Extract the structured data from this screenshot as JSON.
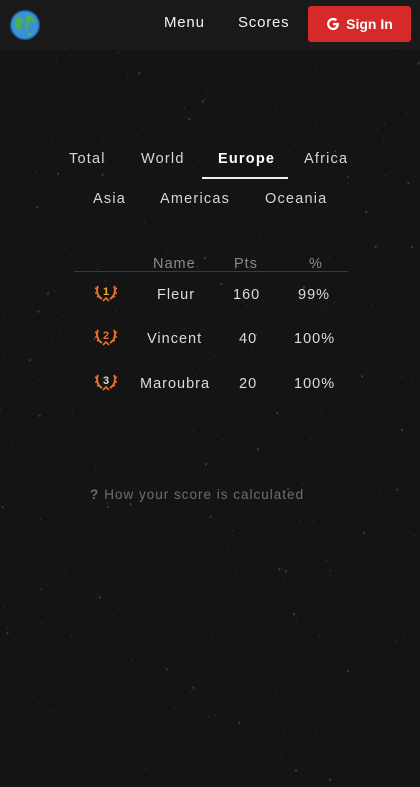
{
  "header": {
    "logo_icon": "globe-icon",
    "menu_label": "Menu",
    "scores_label": "Scores",
    "signin_label": "Sign In",
    "signin_icon": "google-icon",
    "signin_color": "#d62a2a"
  },
  "tabs": [
    {
      "label": "Total",
      "active": false
    },
    {
      "label": "World",
      "active": false
    },
    {
      "label": "Europe",
      "active": true
    },
    {
      "label": "Africa",
      "active": false
    },
    {
      "label": "Asia",
      "active": false
    },
    {
      "label": "Americas",
      "active": false
    },
    {
      "label": "Oceania",
      "active": false
    }
  ],
  "table": {
    "headers": [
      "Name",
      "Pts",
      "%"
    ],
    "rows": [
      {
        "rank": "1",
        "name": "Fleur",
        "pts": "160",
        "pct": "99%"
      },
      {
        "rank": "2",
        "name": "Vincent",
        "pts": "40",
        "pct": "100%"
      },
      {
        "rank": "3",
        "name": "Maroubra",
        "pts": "20",
        "pct": "100%"
      }
    ]
  },
  "help": {
    "icon_text": "?",
    "label": "How your score is calculated"
  },
  "colors": {
    "background": "#141414",
    "medal": "#e8702a",
    "medal_gold": "#f0b030"
  }
}
